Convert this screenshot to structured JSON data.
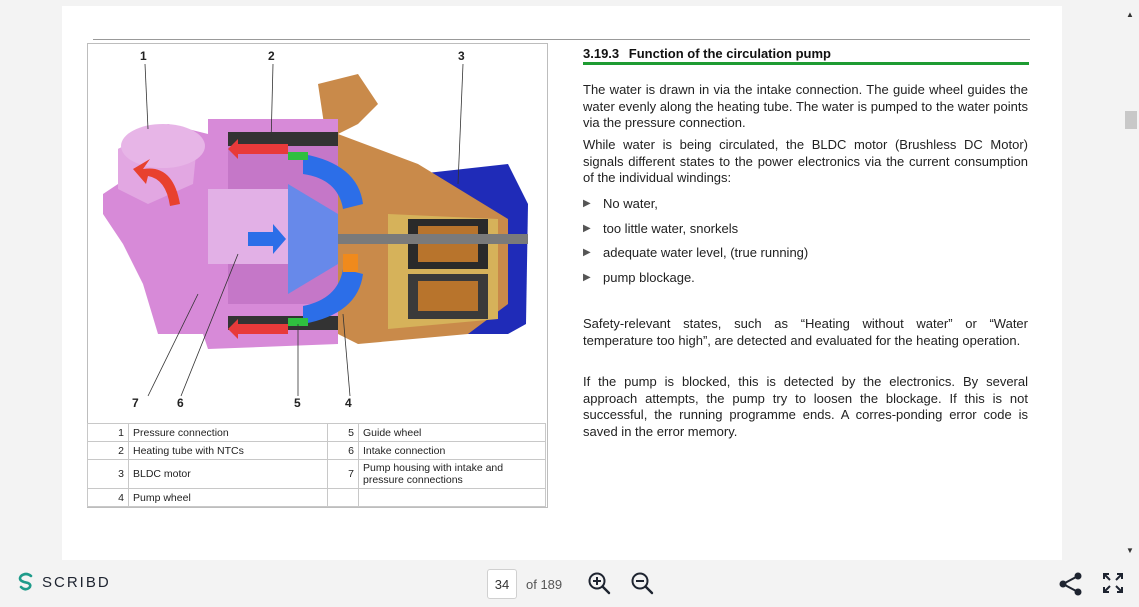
{
  "document": {
    "callouts": {
      "c1": "1",
      "c2": "2",
      "c3": "3",
      "c4": "4",
      "c5": "5",
      "c6": "6",
      "c7": "7"
    },
    "legend": [
      {
        "n1": "1",
        "t1": "Pressure connection",
        "n2": "5",
        "t2": "Guide wheel"
      },
      {
        "n1": "2",
        "t1": "Heating tube with NTCs",
        "n2": "6",
        "t2": "Intake connection"
      },
      {
        "n1": "3",
        "t1": "BLDC motor",
        "n2": "7",
        "t2": "Pump housing with intake and pressure connections"
      },
      {
        "n1": "4",
        "t1": "Pump wheel",
        "n2": "",
        "t2": ""
      }
    ],
    "section_number": "3.19.3",
    "section_title": "Function of the circulation pump",
    "para1": "The water is drawn in via the intake connection. The guide wheel guides the water evenly along the heating tube. The water is pumped to the water points via the pressure connection.",
    "para2": "While water is being circulated, the BLDC motor (Brushless DC Motor) signals different states to the power electronics via the current consumption of the individual windings:",
    "bullets": [
      "No water,",
      "too little water, snorkels",
      "adequate water level, (true running)",
      "pump blockage."
    ],
    "para3": "Safety-relevant states, such as “Heating without water” or “Water temperature too high”, are detected and evaluated for the heating operation.",
    "para4": "If the pump is blocked, this is detected by the electronics. By several approach attempts, the pump try to loosen the blockage. If this is not successful, the running programme ends. A corres-ponding error code is saved in the error memory."
  },
  "toolbar": {
    "logo_text": "SCRIBD",
    "current_page": "34",
    "total_pages": "of 189"
  },
  "colors": {
    "accent_green": "#1e9b32",
    "brand": "#1e2430"
  }
}
